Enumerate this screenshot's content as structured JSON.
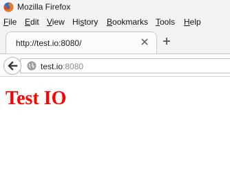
{
  "window": {
    "title": "Mozilla Firefox",
    "logo_icon": "firefox-logo-icon"
  },
  "menubar": {
    "items": [
      {
        "label_ul": "F",
        "label_rest": "ile"
      },
      {
        "label_ul": "E",
        "label_rest": "dit"
      },
      {
        "label_ul": "V",
        "label_rest": "iew"
      },
      {
        "label_pre": "Hi",
        "label_ul": "s",
        "label_rest": "tory"
      },
      {
        "label_ul": "B",
        "label_rest": "ookmarks"
      },
      {
        "label_ul": "T",
        "label_rest": "ools"
      },
      {
        "label_ul": "H",
        "label_rest": "elp"
      }
    ]
  },
  "tabs": [
    {
      "title": "http://test.io:8080/",
      "close_icon": "close-icon"
    }
  ],
  "newtab_icon": "plus-icon",
  "navbar": {
    "back_icon": "back-arrow-icon",
    "site_icon": "globe-icon",
    "url_host": "test.io",
    "url_port": ":8080"
  },
  "page": {
    "heading": "Test IO",
    "heading_color": "#ff0000"
  }
}
